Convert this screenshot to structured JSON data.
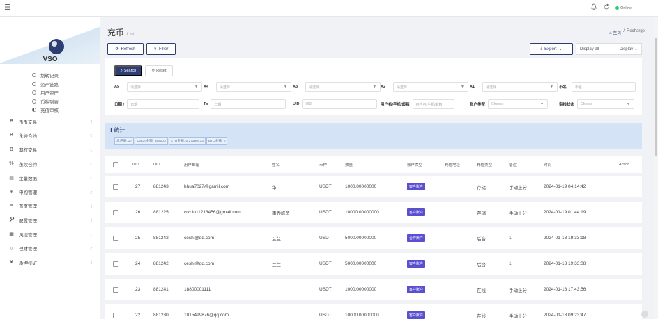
{
  "topbar": {
    "menu_icon": "☰",
    "status": "Online"
  },
  "sidebar": {
    "brand": "VSO",
    "sub_items": [
      {
        "label": "划转记录"
      },
      {
        "label": "资产链路"
      },
      {
        "label": "用户资产"
      },
      {
        "label": "币种列表"
      },
      {
        "label": "充值审核"
      }
    ],
    "nav_items": [
      {
        "label": "币币交易",
        "icon": "B"
      },
      {
        "label": "永续合约",
        "icon": "B"
      },
      {
        "label": "期权交易",
        "icon": "B"
      },
      {
        "label": "永续合约",
        "icon": "%"
      },
      {
        "label": "定量数据",
        "icon": "▤"
      },
      {
        "label": "申购管理",
        "icon": "⊕"
      },
      {
        "label": "首页管理",
        "icon": "≡"
      },
      {
        "label": "配置管理",
        "icon": "🔧"
      },
      {
        "label": "风控管理",
        "icon": "▦"
      },
      {
        "label": "理财管理",
        "icon": "○"
      },
      {
        "label": "质押挖矿",
        "icon": "¥"
      }
    ]
  },
  "page": {
    "title": "充币",
    "subtitle": "List",
    "breadcrumb_home": "主页",
    "breadcrumb_sep": "/",
    "breadcrumb_current": "Recharge"
  },
  "toolbar": {
    "refresh": "Refresh",
    "filter": "Filter",
    "export": "Export",
    "display_all": "Display all",
    "display": "Display"
  },
  "search": {
    "search_label": "Search",
    "reset_label": "Reset",
    "fields_row1": [
      {
        "label": "A5",
        "placeholder": "请选择"
      },
      {
        "label": "A4",
        "placeholder": "请选择"
      },
      {
        "label": "A3",
        "placeholder": "请选择"
      },
      {
        "label": "A2",
        "placeholder": "请选择"
      },
      {
        "label": "A1",
        "placeholder": "请选择"
      },
      {
        "label": "币名",
        "placeholder": "币名"
      }
    ],
    "date_label": "日期 /",
    "date_placeholder": "日期",
    "to_label": "To",
    "to_placeholder": "日期",
    "uid_label": "UID",
    "uid_placeholder": "UID",
    "user_label": "用户名/手机/邮箱",
    "user_placeholder": "用户名/手机/邮箱",
    "user_type_label": "账户类型",
    "user_type_value": "Choose",
    "status_label": "审核状态",
    "status_value": "Choose"
  },
  "stats": {
    "title": "统计",
    "chips": [
      "总记录: 27",
      "USDT金额: 355000",
      "ETH金额: 0.27286413",
      "BTC金额: 0"
    ]
  },
  "table": {
    "headers": {
      "id": "ID ↑",
      "uid": "UID",
      "user": "用户邮箱",
      "name": "姓名",
      "coin": "币种",
      "amount": "数量",
      "acct_type": "账户类型",
      "address": "充值地址",
      "charge_type": "充值类型",
      "remark": "备注",
      "time": "时间",
      "action": "Action"
    },
    "rows": [
      {
        "id": "27",
        "uid": "881243",
        "user": "hhua7027@gamil.com",
        "name": "华",
        "coin": "USDT",
        "amount": "1000.00000000",
        "acct": "客户账户",
        "charge": "存储",
        "remark": "手动上分",
        "time": "2024-01-19 04:14:42"
      },
      {
        "id": "26",
        "uid": "881225",
        "user": "cox.lo11213456@gmail.com",
        "name": "南乔峰鱼",
        "coin": "USDT",
        "amount": "10000.00000000",
        "acct": "客户账户",
        "charge": "存储",
        "remark": "手动上分",
        "time": "2024-01-19 01:44:19"
      },
      {
        "id": "25",
        "uid": "881242",
        "user": "ceshi@qq.com",
        "name": "兰兰",
        "coin": "USDT",
        "amount": "5000.00000000",
        "acct": "合作账户",
        "charge": "后台",
        "remark": "1",
        "time": "2024-01-18 19:33:18"
      },
      {
        "id": "24",
        "uid": "881242",
        "user": "ceshi@qq.com",
        "name": "兰兰",
        "coin": "USDT",
        "amount": "5000.00000000",
        "acct": "客户账户",
        "charge": "后台",
        "remark": "1",
        "time": "2024-01-18 19:33:08"
      },
      {
        "id": "23",
        "uid": "881241",
        "user": "18800001111",
        "name": "",
        "coin": "USDT",
        "amount": "1000.00000000",
        "acct": "客户账户",
        "charge": "在线",
        "remark": "手动上分",
        "time": "2024-01-18 17:43:56"
      },
      {
        "id": "22",
        "uid": "881230",
        "user": "1015499876@qq.com",
        "name": "",
        "coin": "USDT",
        "amount": "10000.00000000",
        "acct": "客户账户",
        "charge": "在线",
        "remark": "手动上分",
        "time": "2024-01-18 09:23:47"
      }
    ]
  }
}
